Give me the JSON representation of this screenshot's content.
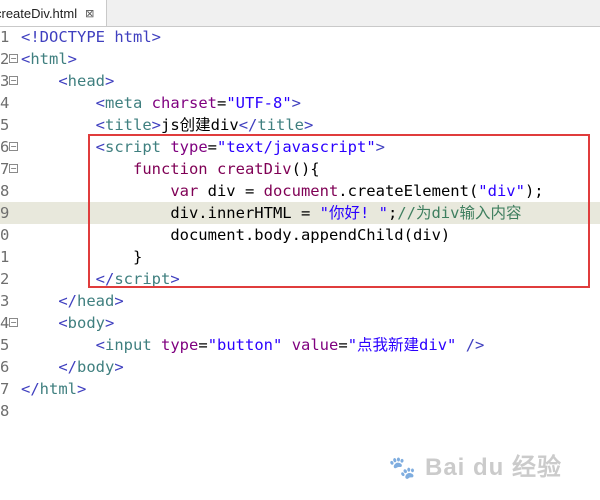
{
  "tab": {
    "label": "createDiv.html",
    "close": "⊠"
  },
  "lines": [
    {
      "num": "1",
      "fold": false
    },
    {
      "num": "2",
      "fold": true
    },
    {
      "num": "3",
      "fold": true
    },
    {
      "num": "4",
      "fold": false
    },
    {
      "num": "5",
      "fold": false
    },
    {
      "num": "6",
      "fold": true
    },
    {
      "num": "7",
      "fold": true
    },
    {
      "num": "8",
      "fold": false
    },
    {
      "num": "9",
      "fold": false,
      "current": true
    },
    {
      "num": "0",
      "fold": false
    },
    {
      "num": "1",
      "fold": false
    },
    {
      "num": "2",
      "fold": false
    },
    {
      "num": "3",
      "fold": false
    },
    {
      "num": "4",
      "fold": true
    },
    {
      "num": "5",
      "fold": false
    },
    {
      "num": "6",
      "fold": false
    },
    {
      "num": "7",
      "fold": false
    },
    {
      "num": "8",
      "fold": false
    }
  ],
  "code": {
    "l1": "<!DOCTYPE html>",
    "l2_tag": "html",
    "l3_tag": "head",
    "l4_tag": "meta",
    "l4_attr": "charset",
    "l4_val": "\"UTF-8\"",
    "l5_tag": "title",
    "l5_text": "js创建div",
    "l6_tag": "script",
    "l6_attr": "type",
    "l6_val": "\"text/javascript\"",
    "l7_kw": "function",
    "l7_name": "creatDiv",
    "l7_rest": "(){",
    "l8_kw": "var",
    "l8_mid": " div = ",
    "l8_obj": "document",
    "l8_call": ".createElement(",
    "l8_str": "\"div\"",
    "l8_end": ");",
    "l9_lhs": "div.innerHTML = ",
    "l9_str": "\"你好! \"",
    "l9_semi": ";",
    "l9_comment": "//为div输入内容",
    "l10": "document.body.appendChild(div)",
    "l11": "}",
    "l12_tag": "script",
    "l13_tag": "head",
    "l14_tag": "body",
    "l15_tag": "input",
    "l15_attr1": "type",
    "l15_val1": "\"button\"",
    "l15_attr2": "value",
    "l15_val2": "\"点我新建div\"",
    "l16_tag": "body",
    "l17_tag": "html"
  },
  "watermark": "Bai du 经验"
}
